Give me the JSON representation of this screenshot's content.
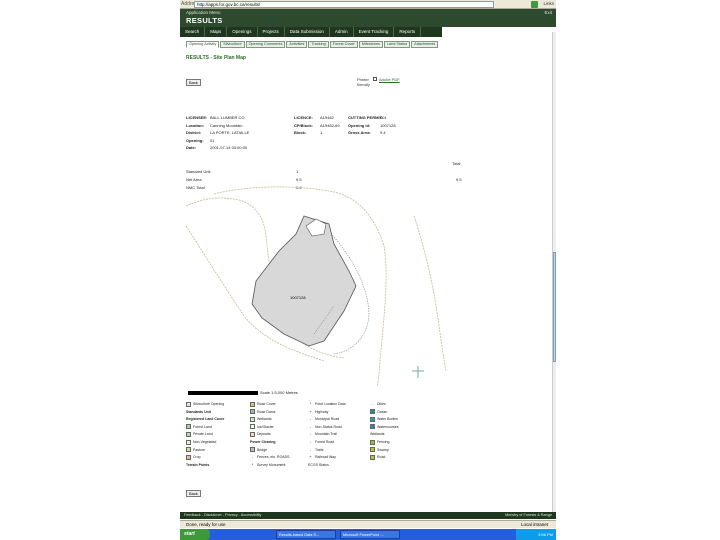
{
  "browser": {
    "address_label": "Address",
    "url": "http://apps.for.gov.bc.ca/results/",
    "links_label": "Links"
  },
  "app": {
    "breadcrumb": "Application Menu",
    "title": "RESULTS",
    "logout": "Exit"
  },
  "main_nav": [
    "Search",
    "Maps",
    "Openings",
    "Projects",
    "Data Submission",
    "Admin",
    "Event Tracking",
    "Reports"
  ],
  "sub_tabs": [
    "Opening Activity",
    "Silviculture",
    "Opening Comments",
    "Activities",
    "Tracking",
    "Forest Cover",
    "Milestones",
    "Land Status",
    "Attachments"
  ],
  "page_title": "RESULTS - Site Plan Map",
  "buttons": {
    "back_top": "Back",
    "back_bottom": "Back"
  },
  "print": {
    "label": "Printer friendly",
    "pdf_label": "Adobe PDF"
  },
  "info_rows": [
    [
      "LICENSEE:",
      "BALL LUMBER CO.",
      "LICENCE:",
      "A19482",
      "CUTTING PERMIT:",
      "001"
    ],
    [
      "Location:",
      "Canning Mountain",
      "CP/Block:",
      "A19482-69",
      "Opening id:",
      "1007128"
    ],
    [
      "District:",
      "LA PORTE, LATAILLE",
      "Block:",
      "1",
      "Gross Area:",
      "9.4"
    ],
    [
      "Opening:",
      "01",
      "",
      "",
      "",
      ""
    ],
    [
      "Date:",
      "2001-07-14 00:00:00",
      "",
      "",
      "",
      ""
    ]
  ],
  "stats": {
    "col_header": "Total",
    "rows": [
      [
        "Standard Unit",
        "1",
        ""
      ],
      [
        "Net Area",
        "9.5",
        "9.5"
      ],
      [
        "NMC Total",
        "0.4",
        ""
      ]
    ]
  },
  "map": {
    "polygon_label": "1007128"
  },
  "scale_label": "Scale 1:5,000 Metres",
  "legend": [
    {
      "label": "Silviculture Opening",
      "kind": "swatch",
      "color": "#e8e8e8"
    },
    {
      "label": "Road Cover",
      "kind": "swatch",
      "color": "#d8c080"
    },
    {
      "label": "Point Location Data",
      "kind": "symbol",
      "symbol": "*"
    },
    {
      "label": "Dikes",
      "kind": "line",
      "color": "#d8c080"
    },
    {
      "label": "Standards Unit",
      "kind": "bold",
      "color": "#333333"
    },
    {
      "label": "Road Dams",
      "kind": "swatch",
      "color": "#9fb89f"
    },
    {
      "label": "Highway",
      "kind": "symbol",
      "symbol": "+"
    },
    {
      "label": "Ocean",
      "kind": "swatch",
      "color": "#1f8f8f"
    },
    {
      "label": "Registered Land Cover",
      "kind": "bold",
      "color": "#333333"
    },
    {
      "label": "Wetlands",
      "kind": "swatch",
      "color": "#cfe6cf"
    },
    {
      "label": "Municipal Road",
      "kind": "symbol",
      "symbol": "-"
    },
    {
      "label": "Water Bodies",
      "kind": "swatch",
      "color": "#2f9f9f"
    },
    {
      "label": "Forest Land",
      "kind": "swatch",
      "color": "#a6cfa6"
    },
    {
      "label": "Ice/Glacier",
      "kind": "swatch",
      "color": "#f6f6e6"
    },
    {
      "label": "Non-Status Road",
      "kind": "symbol",
      "symbol": "-"
    },
    {
      "label": "Watercourses",
      "kind": "swatch",
      "color": "#3f7fbf"
    },
    {
      "label": "Private Land",
      "kind": "swatch",
      "color": "#b8d8b8"
    },
    {
      "label": "Deposits",
      "kind": "swatch",
      "color": "#f6d8a8"
    },
    {
      "label": "Mountain Trail",
      "kind": "symbol",
      "symbol": "-"
    },
    {
      "label": "Wetlands",
      "kind": "plain",
      "color": "#333333"
    },
    {
      "label": "Non-Vegetated",
      "kind": "swatch",
      "color": "#f0f0c8"
    },
    {
      "label": "Power Clearing",
      "kind": "bold",
      "color": "#333333"
    },
    {
      "label": "Forest Road",
      "kind": "symbol",
      "symbol": "-"
    },
    {
      "label": "Fencing",
      "kind": "swatch",
      "color": "#8fbf3f"
    },
    {
      "label": "Pasture",
      "kind": "swatch",
      "color": "#d8d8a8"
    },
    {
      "label": "Bridge",
      "kind": "swatch",
      "color": "#bbbbbb"
    },
    {
      "label": "Trails",
      "kind": "symbol",
      "symbol": "-"
    },
    {
      "label": "Swamp",
      "kind": "swatch",
      "color": "#bfbf3f"
    },
    {
      "label": "Crop",
      "kind": "swatch",
      "color": "#e0b8a0"
    },
    {
      "label": "Fences, etc. ROADS",
      "kind": "symbol",
      "symbol": "-"
    },
    {
      "label": "Railroad Way",
      "kind": "symbol",
      "symbol": "+"
    },
    {
      "label": "Road",
      "kind": "swatch",
      "color": "#a8c83f"
    },
    {
      "label": "Terrain Points",
      "kind": "bold",
      "color": "#333333"
    },
    {
      "label": "Survey Monument",
      "kind": "symbol",
      "symbol": "*"
    },
    {
      "label": "ECGS Status",
      "kind": "plain",
      "color": "#333333"
    }
  ],
  "footer": {
    "left": "Feedback  -  Disclaimer  -  Privacy  -  Accessibility",
    "right": "Ministry of Forests & Range"
  },
  "status_bar": {
    "left": "Done, ready for use",
    "right": "Local intranet"
  },
  "taskbar": {
    "start": "start",
    "tasks": [
      "Results-based Data S...",
      "Microsoft PowerPoint -..."
    ],
    "clock": "3:56 PM"
  }
}
